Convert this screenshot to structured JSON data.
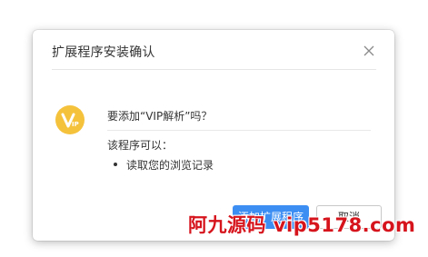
{
  "dialog": {
    "title": "扩展程序安装确认",
    "close_icon": "close-icon",
    "question": "要添加“VIP解析”吗？",
    "permissions_heading": "该程序可以：",
    "permissions": [
      "读取您的浏览记录"
    ],
    "extension_icon": "vip-badge-icon",
    "accent_color": "#3c8ef3",
    "icon_color": "#f5c23c"
  },
  "buttons": {
    "add_label": "添加扩展程序",
    "cancel_label": "取消"
  },
  "watermark": {
    "text": "阿九源码 vip5178.com"
  }
}
